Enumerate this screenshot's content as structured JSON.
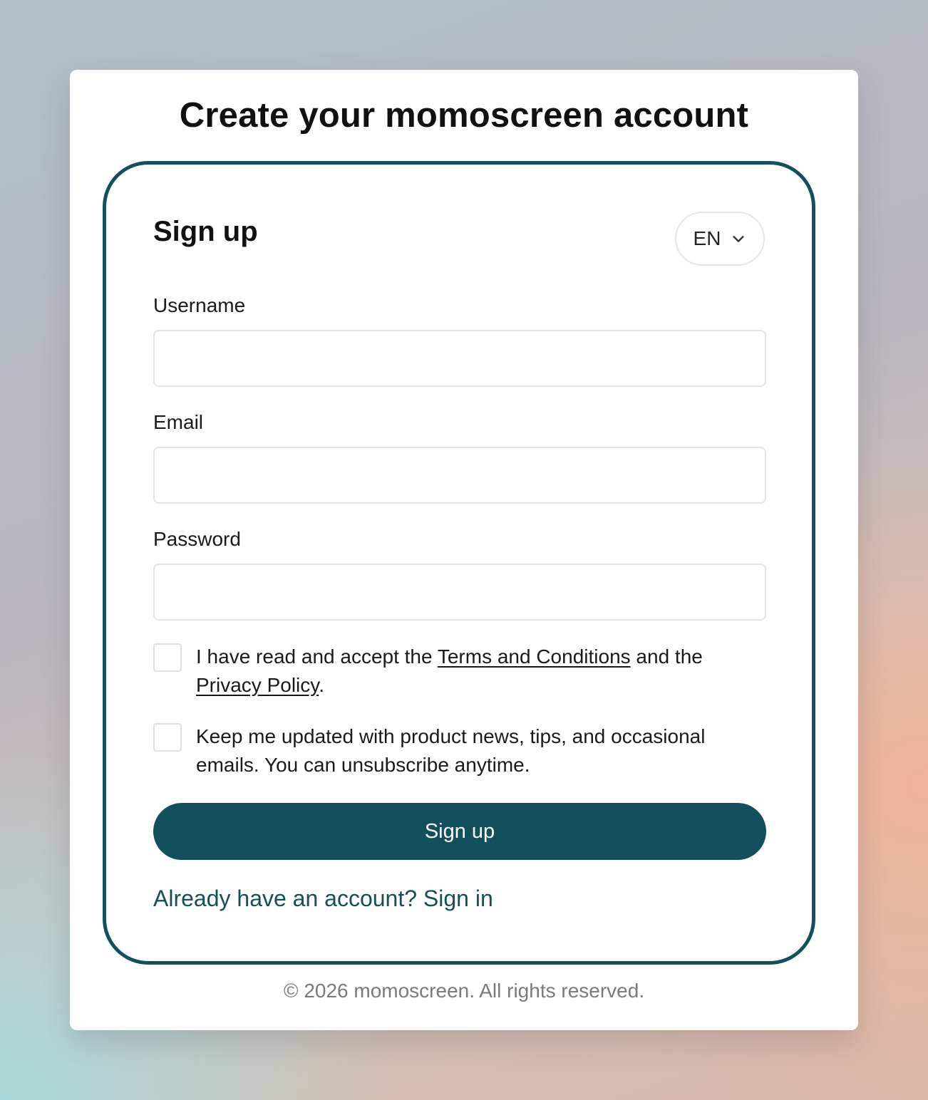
{
  "page": {
    "title": "Create your momoscreen account",
    "footer": "© 2026 momoscreen. All rights reserved."
  },
  "form": {
    "heading": "Sign up",
    "language": {
      "selected": "EN"
    },
    "fields": {
      "username": {
        "label": "Username",
        "value": "",
        "placeholder": ""
      },
      "email": {
        "label": "Email",
        "value": "",
        "placeholder": ""
      },
      "password": {
        "label": "Password",
        "value": "",
        "placeholder": ""
      }
    },
    "terms": {
      "checked": false,
      "text_before": "I have read and accept the ",
      "terms_link": "Terms and Conditions",
      "text_middle": " and the ",
      "privacy_link": "Privacy Policy",
      "text_after": "."
    },
    "newsletter": {
      "checked": false,
      "text": "Keep me updated with product news, tips, and occasional emails. You can unsubscribe anytime."
    },
    "submit_label": "Sign up",
    "signin_link": "Already have an account? Sign in"
  },
  "colors": {
    "accent": "#134f5c",
    "card_background": "#ffffff",
    "footer_text": "#7a7a7e"
  }
}
